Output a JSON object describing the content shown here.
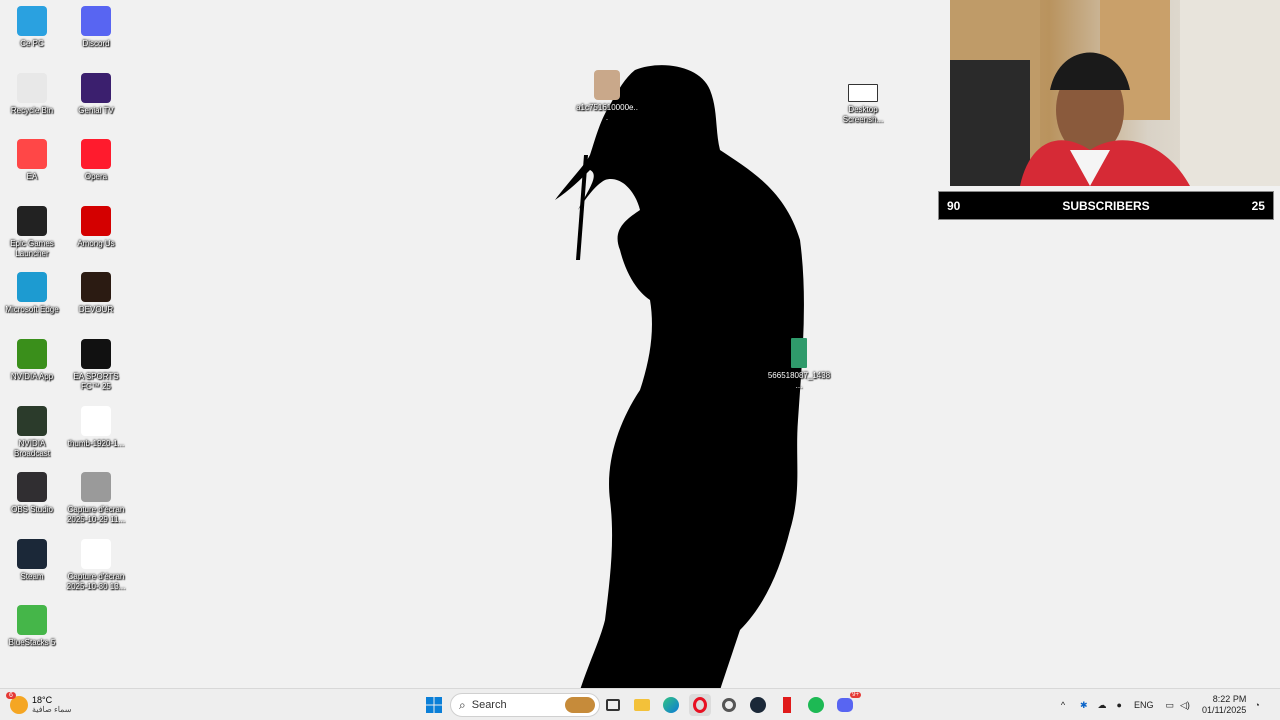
{
  "desktop": {
    "icons": [
      {
        "label": "Ce PC",
        "icon": "monitor-icon",
        "color": "#2aa1e0"
      },
      {
        "label": "Discord",
        "icon": "discord-icon",
        "color": "#5865f2"
      },
      {
        "label": "Recycle Bin",
        "icon": "recycle-bin-icon",
        "color": "#e8e8e8"
      },
      {
        "label": "Genial TV",
        "icon": "genial-tv-icon",
        "color": "#3b1f6e"
      },
      {
        "label": "EA",
        "icon": "ea-icon",
        "color": "#ff4747"
      },
      {
        "label": "Opera",
        "icon": "opera-icon",
        "color": "#ff1b2d"
      },
      {
        "label": "Epic Games Launcher",
        "icon": "epic-games-icon",
        "color": "#222222"
      },
      {
        "label": "Among Us",
        "icon": "among-us-icon",
        "color": "#d40000"
      },
      {
        "label": "Microsoft Edge",
        "icon": "edge-icon",
        "color": "#1d9bd1"
      },
      {
        "label": "DEVOUR",
        "icon": "devour-icon",
        "color": "#2b1b12"
      },
      {
        "label": "NVIDIA App",
        "icon": "nvidia-icon",
        "color": "#3a8f1b"
      },
      {
        "label": "EA SPORTS FC™ 25",
        "icon": "ea-fc-icon",
        "color": "#111111"
      },
      {
        "label": "NVIDIA Broadcast",
        "icon": "nvidia-broadcast-icon",
        "color": "#2b3b2b"
      },
      {
        "label": "thumb-1920-1...",
        "icon": "image-file-icon",
        "color": "#ffffff"
      },
      {
        "label": "OBS Studio",
        "icon": "obs-icon",
        "color": "#302e31"
      },
      {
        "label": "Capture d'écran 2025-10-29 11...",
        "icon": "screenshot-file-icon",
        "color": "#9a9a9a"
      },
      {
        "label": "Steam",
        "icon": "steam-icon",
        "color": "#1b2838"
      },
      {
        "label": "Capture d'écran 2025-10-30 13...",
        "icon": "screenshot-file-icon",
        "color": "#ffffff"
      },
      {
        "label": "BlueStacks 5",
        "icon": "bluestacks-icon",
        "color": "#45b649"
      }
    ],
    "floating_icons": [
      {
        "label": "a1c751610000e...",
        "icon": "photo-file-icon"
      },
      {
        "label": "Desktop Screensh...",
        "icon": "screenshot-file-icon"
      },
      {
        "label": "566518087_1438...",
        "icon": "image-file-icon"
      }
    ]
  },
  "overlay": {
    "left_count": "90",
    "title": "SUBSCRIBERS",
    "right_count": "25"
  },
  "taskbar": {
    "weather": {
      "temp": "18°C",
      "desc": "سماء صافية",
      "badge": "6"
    },
    "search_placeholder": "Search",
    "apps": [
      "start-icon",
      "search-icon",
      "widgets-icon",
      "task-view-icon",
      "file-explorer-icon",
      "edge-icon",
      "opera-icon",
      "settings-icon",
      "steam-icon",
      "red-app-icon",
      "spotify-icon",
      "discord-icon"
    ],
    "discord_badge": "9+",
    "tray": {
      "language": "ENG",
      "time": "8:22 PM",
      "date": "01/11/2025"
    }
  }
}
